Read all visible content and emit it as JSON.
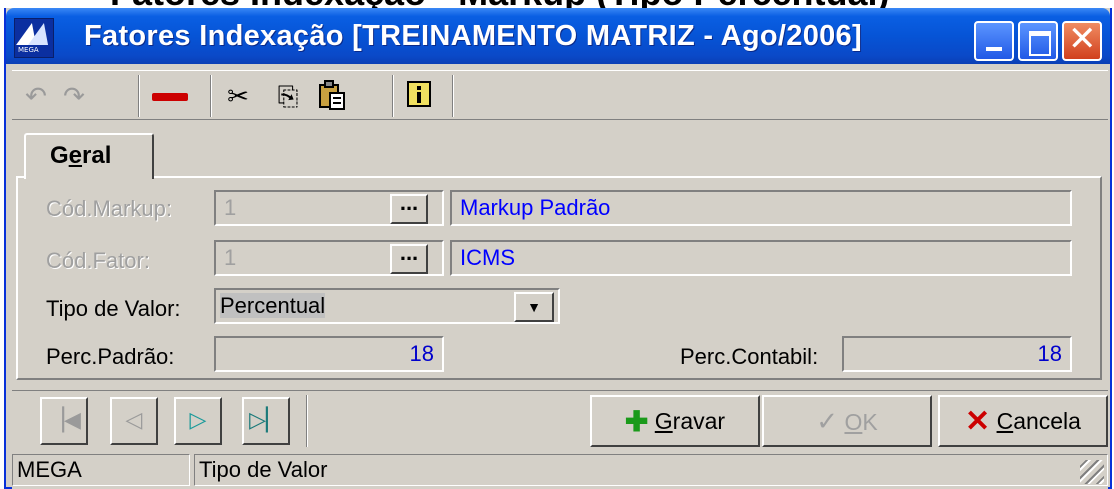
{
  "cropped_header": "Fatores Indexação - Markup (Tipo Percentual)",
  "window": {
    "title": "Fatores Indexação [TREINAMENTO MATRIZ - Ago/2006]",
    "caption_buttons": {
      "minimize_icon": "minimize-icon",
      "maximize_icon": "maximize-icon",
      "close_icon": "close-icon"
    }
  },
  "toolbar": {
    "items": [
      {
        "name": "undo-icon",
        "glyph": "↶",
        "enabled": false
      },
      {
        "name": "redo-icon",
        "glyph": "↷",
        "enabled": false
      },
      {
        "name": "delete-icon",
        "glyph": "▬",
        "enabled": true,
        "color": "#cc0000"
      },
      {
        "name": "cut-icon",
        "glyph": "✂",
        "enabled": true
      },
      {
        "name": "copy-icon",
        "glyph": "⎘",
        "enabled": true
      },
      {
        "name": "paste-icon",
        "glyph": "📋",
        "enabled": true
      },
      {
        "name": "info-icon",
        "glyph": "ℹ",
        "enabled": true
      }
    ]
  },
  "tabs": [
    {
      "label_prefix": "G",
      "label_underlined": "e",
      "label_suffix": "ral",
      "active": true
    }
  ],
  "form": {
    "cod_markup": {
      "label": "Cód.Markup:",
      "value": "1",
      "description": "Markup Padrão",
      "enabled": false
    },
    "cod_fator": {
      "label": "Cód.Fator:",
      "value": "1",
      "description": "ICMS",
      "enabled": false
    },
    "tipo_valor": {
      "label": "Tipo de Valor:",
      "value": "Percentual"
    },
    "perc_padrao": {
      "label": "Perc.Padrão:",
      "value": "18"
    },
    "perc_contabil": {
      "label": "Perc.Contabil:",
      "value": "18"
    },
    "ellipsis": "..."
  },
  "nav": {
    "first_icon": "first-record-icon",
    "prev_icon": "previous-record-icon",
    "next_icon": "next-record-icon",
    "last_icon": "last-record-icon"
  },
  "actions": {
    "save": {
      "u": "G",
      "rest": "ravar",
      "icon": "plus-icon"
    },
    "ok": {
      "u": "O",
      "rest": "K",
      "icon": "check-icon",
      "enabled": false
    },
    "cancel": {
      "u": "C",
      "rest": "ancela",
      "icon": "x-icon"
    }
  },
  "status": {
    "panel1": "MEGA",
    "panel2": "Tipo de Valor"
  },
  "colors": {
    "title_blue": "#0654d6",
    "desc_text": "#0000ff",
    "value_text": "#0000cc",
    "close_red": "#d1401e"
  }
}
